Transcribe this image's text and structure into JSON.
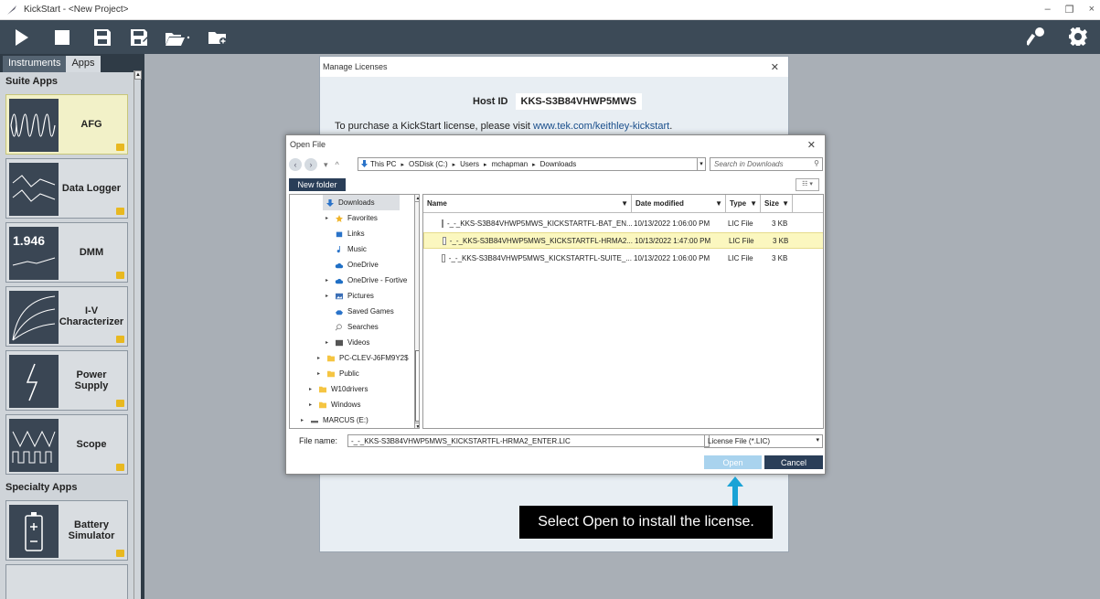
{
  "window": {
    "title": "KickStart - <New Project>",
    "controls": [
      "–",
      "❐",
      "×"
    ]
  },
  "toolbar": {
    "left_buttons": [
      "run-icon",
      "stop-icon",
      "save-icon",
      "save-as-icon",
      "open-project-icon",
      "new-folder-icon"
    ],
    "right_buttons": [
      "key-icon",
      "gear-icon"
    ]
  },
  "sidebar": {
    "tabs": [
      "Instruments",
      "Apps"
    ],
    "active_tab": "Apps",
    "suite_title": "Suite Apps",
    "suite_apps": [
      {
        "label": "AFG",
        "selected": true
      },
      {
        "label": "Data Logger"
      },
      {
        "label": "DMM",
        "thumb_text": "1.946"
      },
      {
        "label": "I-V Characterizer"
      },
      {
        "label": "Power Supply"
      },
      {
        "label": "Scope"
      }
    ],
    "specialty_title": "Specialty Apps",
    "specialty_apps": [
      {
        "label": "Battery Simulator"
      }
    ]
  },
  "manage_licenses": {
    "title": "Manage Licenses",
    "host_id_label": "Host ID",
    "host_id_value": "KKS-S3B84VHWP5MWS",
    "purchase_text": "To purchase a KickStart license, please visit ",
    "purchase_link": "www.tek.com/keithley-kickstart",
    "purchase_end": "."
  },
  "open_file": {
    "title": "Open File",
    "path": [
      "This PC",
      "OSDisk (C:)",
      "Users",
      "mchapman",
      "Downloads"
    ],
    "search_placeholder": "Search in Downloads",
    "new_folder_label": "New folder",
    "tree": [
      {
        "label": "Downloads",
        "indent": 2,
        "icon": "download-icon",
        "selected": true
      },
      {
        "label": "Favorites",
        "indent": 2,
        "icon": "star-icon",
        "expand": true
      },
      {
        "label": "Links",
        "indent": 2,
        "icon": "link-icon"
      },
      {
        "label": "Music",
        "indent": 2,
        "icon": "music-icon"
      },
      {
        "label": "OneDrive",
        "indent": 2,
        "icon": "cloud-icon"
      },
      {
        "label": "OneDrive - Fortive",
        "indent": 2,
        "icon": "cloud-icon",
        "expand": true
      },
      {
        "label": "Pictures",
        "indent": 2,
        "icon": "pictures-icon",
        "expand": true
      },
      {
        "label": "Saved Games",
        "indent": 2,
        "icon": "games-icon"
      },
      {
        "label": "Searches",
        "indent": 2,
        "icon": "search-icon"
      },
      {
        "label": "Videos",
        "indent": 2,
        "icon": "video-icon",
        "expand": true
      },
      {
        "label": "PC-CLEV-J6FM9Y2$",
        "indent": 1,
        "icon": "folder-icon",
        "expand": true
      },
      {
        "label": "Public",
        "indent": 1,
        "icon": "folder-icon",
        "expand": true
      },
      {
        "label": "W10drivers",
        "indent": 0,
        "icon": "folder-icon",
        "expand": true
      },
      {
        "label": "Windows",
        "indent": 0,
        "icon": "folder-icon",
        "expand": true
      },
      {
        "label": "MARCUS (E:)",
        "indent": -1,
        "icon": "drive-icon",
        "expand": true
      }
    ],
    "columns": [
      "Name",
      "Date modified",
      "Type",
      "Size"
    ],
    "files": [
      {
        "name": "-_-_KKS-S3B84VHWP5MWS_KICKSTARTFL-BAT_EN...",
        "date": "10/13/2022 1:06:00 PM",
        "type": "LIC File",
        "size": "3 KB"
      },
      {
        "name": "-_-_KKS-S3B84VHWP5MWS_KICKSTARTFL-HRMA2...",
        "date": "10/13/2022 1:47:00 PM",
        "type": "LIC File",
        "size": "3 KB",
        "selected": true
      },
      {
        "name": "-_-_KKS-S3B84VHWP5MWS_KICKSTARTFL-SUITE_...",
        "date": "10/13/2022 1:06:00 PM",
        "type": "LIC File",
        "size": "3 KB"
      }
    ],
    "file_name_label": "File name:",
    "file_name_value": "-_-_KKS-S3B84VHWP5MWS_KICKSTARTFL-HRMA2_ENTER.LIC",
    "file_type": "License File (*.LIC)",
    "open_label": "Open",
    "cancel_label": "Cancel"
  },
  "callout": {
    "text": "Select Open to install the license.",
    "color": "#1aa3d6"
  }
}
